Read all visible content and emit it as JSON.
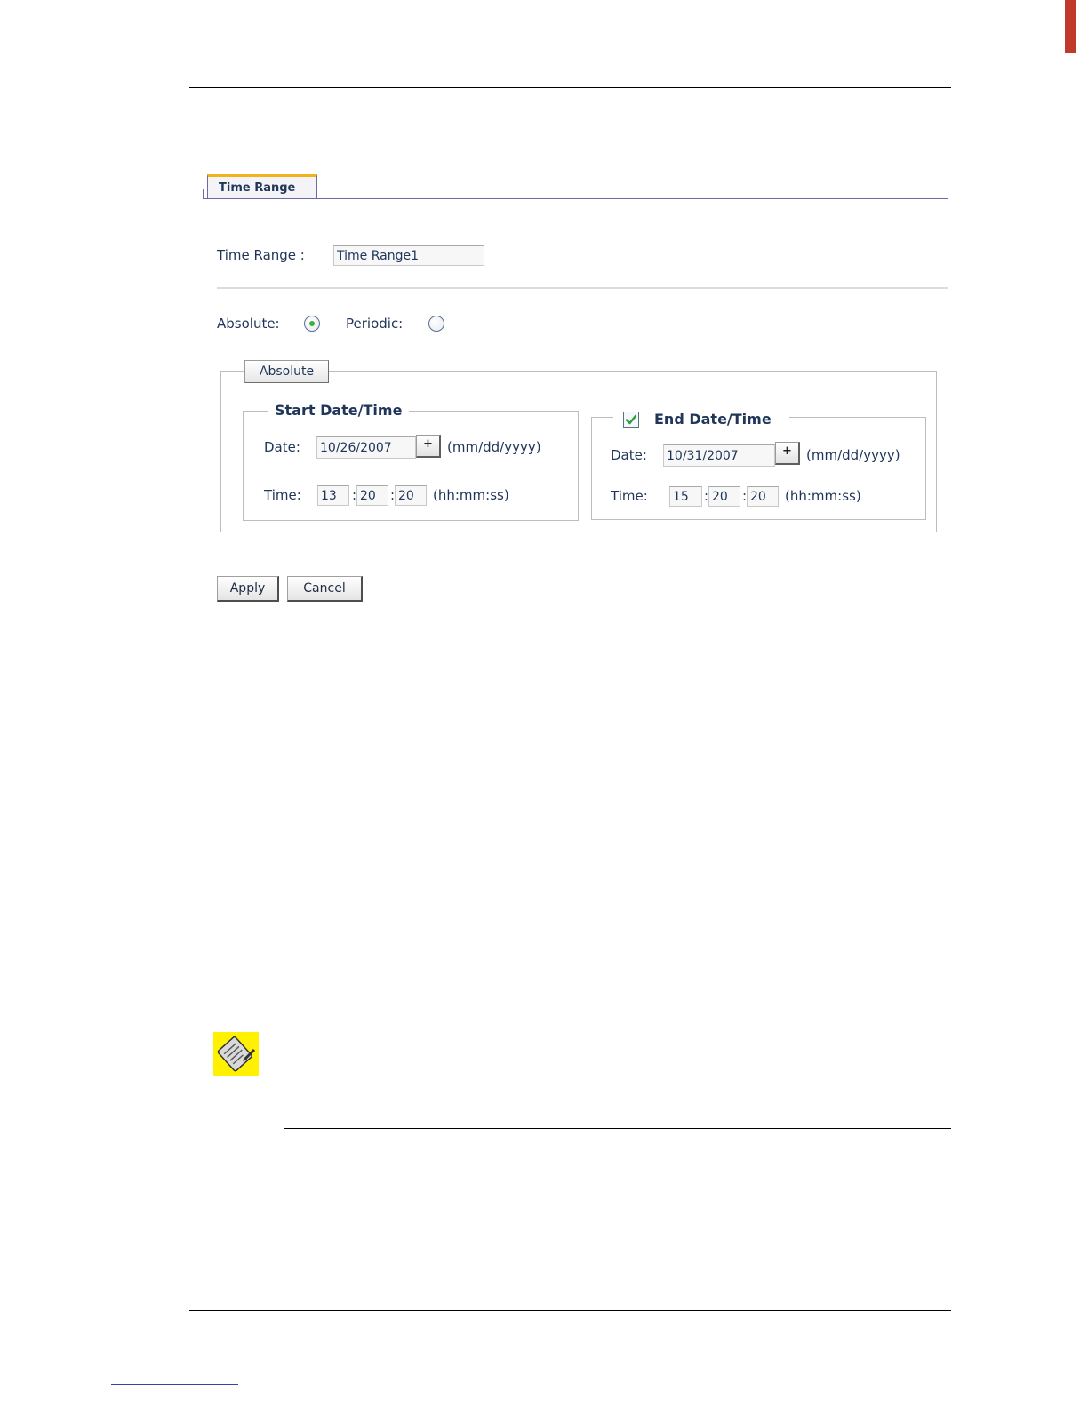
{
  "tab": {
    "label": "Time Range"
  },
  "form": {
    "time_range_label": "Time Range :",
    "time_range_value": "Time Range1",
    "absolute_label": "Absolute:",
    "periodic_label": "Periodic:",
    "mode_selected": "Absolute"
  },
  "absolute_group": {
    "legend": "Absolute",
    "start": {
      "title": "Start Date/Time",
      "date_label": "Date:",
      "date_value": "10/26/2007",
      "date_button": "+",
      "date_format": "(mm/dd/yyyy)",
      "time_label": "Time:",
      "hh": "13",
      "mm": "20",
      "ss": "20",
      "colon": ":",
      "time_format": "(hh:mm:ss)"
    },
    "end": {
      "title": "End Date/Time",
      "enabled": true,
      "date_label": "Date:",
      "date_value": "10/31/2007",
      "date_button": "+",
      "date_format": "(mm/dd/yyyy)",
      "time_label": "Time:",
      "hh": "15",
      "mm": "20",
      "ss": "20",
      "colon": ":",
      "time_format": "(hh:mm:ss)"
    }
  },
  "buttons": {
    "apply": "Apply",
    "cancel": "Cancel"
  },
  "icons": {
    "note": "note-pencil-icon",
    "checkbox_check": "check-icon"
  },
  "colors": {
    "tab_accent": "#f2b21c",
    "note_bg": "#fff100",
    "radio_dot": "#3fae3a",
    "check": "#2e9e3a"
  }
}
